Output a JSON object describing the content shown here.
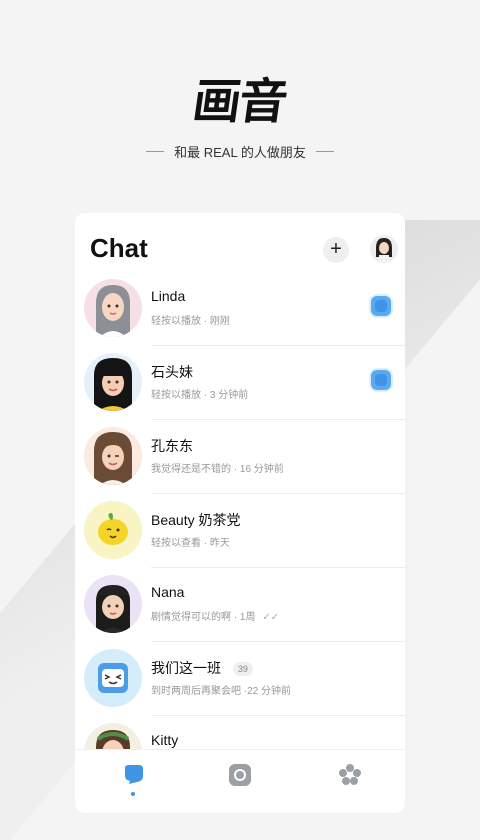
{
  "brand": {
    "logo": "画音",
    "tagline": "和最 REAL 的人做朋友"
  },
  "header": {
    "title": "Chat",
    "add_label": "+"
  },
  "chats": [
    {
      "name": "Linda",
      "preview": "轻按以播放 · 刚刚",
      "unread": true,
      "avatar": "girl-gray-hair-avatar"
    },
    {
      "name": "石头妹",
      "preview": "轻按以播放 · 3 分钟前",
      "unread": true,
      "avatar": "girl-bangs-avatar"
    },
    {
      "name": "孔东东",
      "preview": "我觉得还是不错的 · 16 分钟前",
      "unread": false,
      "avatar": "girl-wink-avatar"
    },
    {
      "name": "Beauty 奶茶党",
      "preview": "轻按以查看 · 昨天",
      "unread": false,
      "avatar": "lemon-avatar"
    },
    {
      "name": "Nana",
      "preview": "剧情觉得可以的啊 · 1周",
      "read_check": "✓✓",
      "unread": false,
      "avatar": "girl-cap-avatar"
    },
    {
      "name": "我们这一班",
      "badge": "39",
      "preview": "到时两周后再聚会吧 ·22 分钟前",
      "unread": false,
      "avatar": "robot-group-avatar"
    },
    {
      "name": "Kitty",
      "preview": "",
      "unread": false,
      "avatar": "girl-headband-avatar"
    }
  ],
  "tabs": [
    "chat-tab",
    "camera-tab",
    "discover-tab"
  ],
  "colors": {
    "accent": "#3f94e6",
    "background": "#f4f4f4"
  }
}
